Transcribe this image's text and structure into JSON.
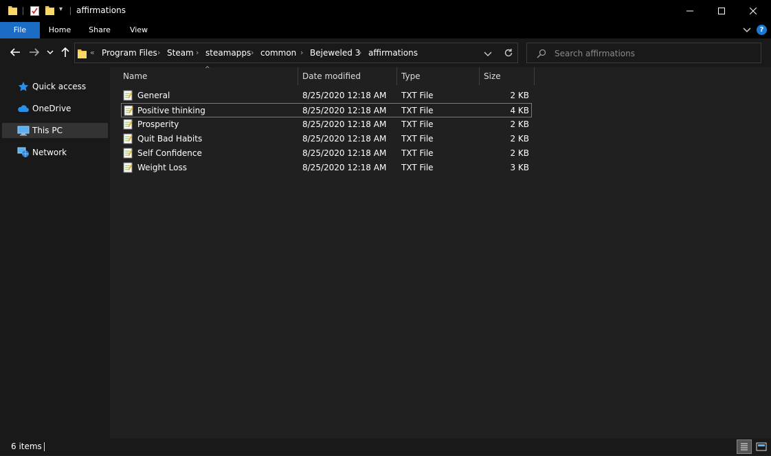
{
  "window": {
    "title": "affirmations"
  },
  "ribbon": {
    "tabs": [
      {
        "label": "File"
      },
      {
        "label": "Home"
      },
      {
        "label": "Share"
      },
      {
        "label": "View"
      }
    ],
    "help_label": "?"
  },
  "address_bar": {
    "overflow": "«",
    "breadcrumbs": [
      "Program Files",
      "Steam",
      "steamapps",
      "common",
      "Bejeweled 3",
      "affirmations"
    ]
  },
  "search": {
    "placeholder": "Search affirmations",
    "value": ""
  },
  "nav_pane": {
    "items": [
      {
        "label": "Quick access",
        "icon": "star-icon"
      },
      {
        "label": "OneDrive",
        "icon": "cloud-icon"
      },
      {
        "label": "This PC",
        "icon": "computer-icon",
        "selected": true
      },
      {
        "label": "Network",
        "icon": "network-icon"
      }
    ]
  },
  "columns": {
    "name": "Name",
    "date": "Date modified",
    "type": "Type",
    "size": "Size",
    "sort_indicator": "^"
  },
  "files": [
    {
      "name": "General",
      "date": "8/25/2020 12:18 AM",
      "type": "TXT File",
      "size": "2 KB"
    },
    {
      "name": "Positive thinking",
      "date": "8/25/2020 12:18 AM",
      "type": "TXT File",
      "size": "4 KB"
    },
    {
      "name": "Prosperity",
      "date": "8/25/2020 12:18 AM",
      "type": "TXT File",
      "size": "2 KB"
    },
    {
      "name": "Quit Bad Habits",
      "date": "8/25/2020 12:18 AM",
      "type": "TXT File",
      "size": "2 KB"
    },
    {
      "name": "Self Confidence",
      "date": "8/25/2020 12:18 AM",
      "type": "TXT File",
      "size": "2 KB"
    },
    {
      "name": "Weight Loss",
      "date": "8/25/2020 12:18 AM",
      "type": "TXT File",
      "size": "3 KB"
    }
  ],
  "status": {
    "item_count": "6 items"
  },
  "colors": {
    "accent": "#1a6cc4",
    "folder": "#f5c542"
  }
}
